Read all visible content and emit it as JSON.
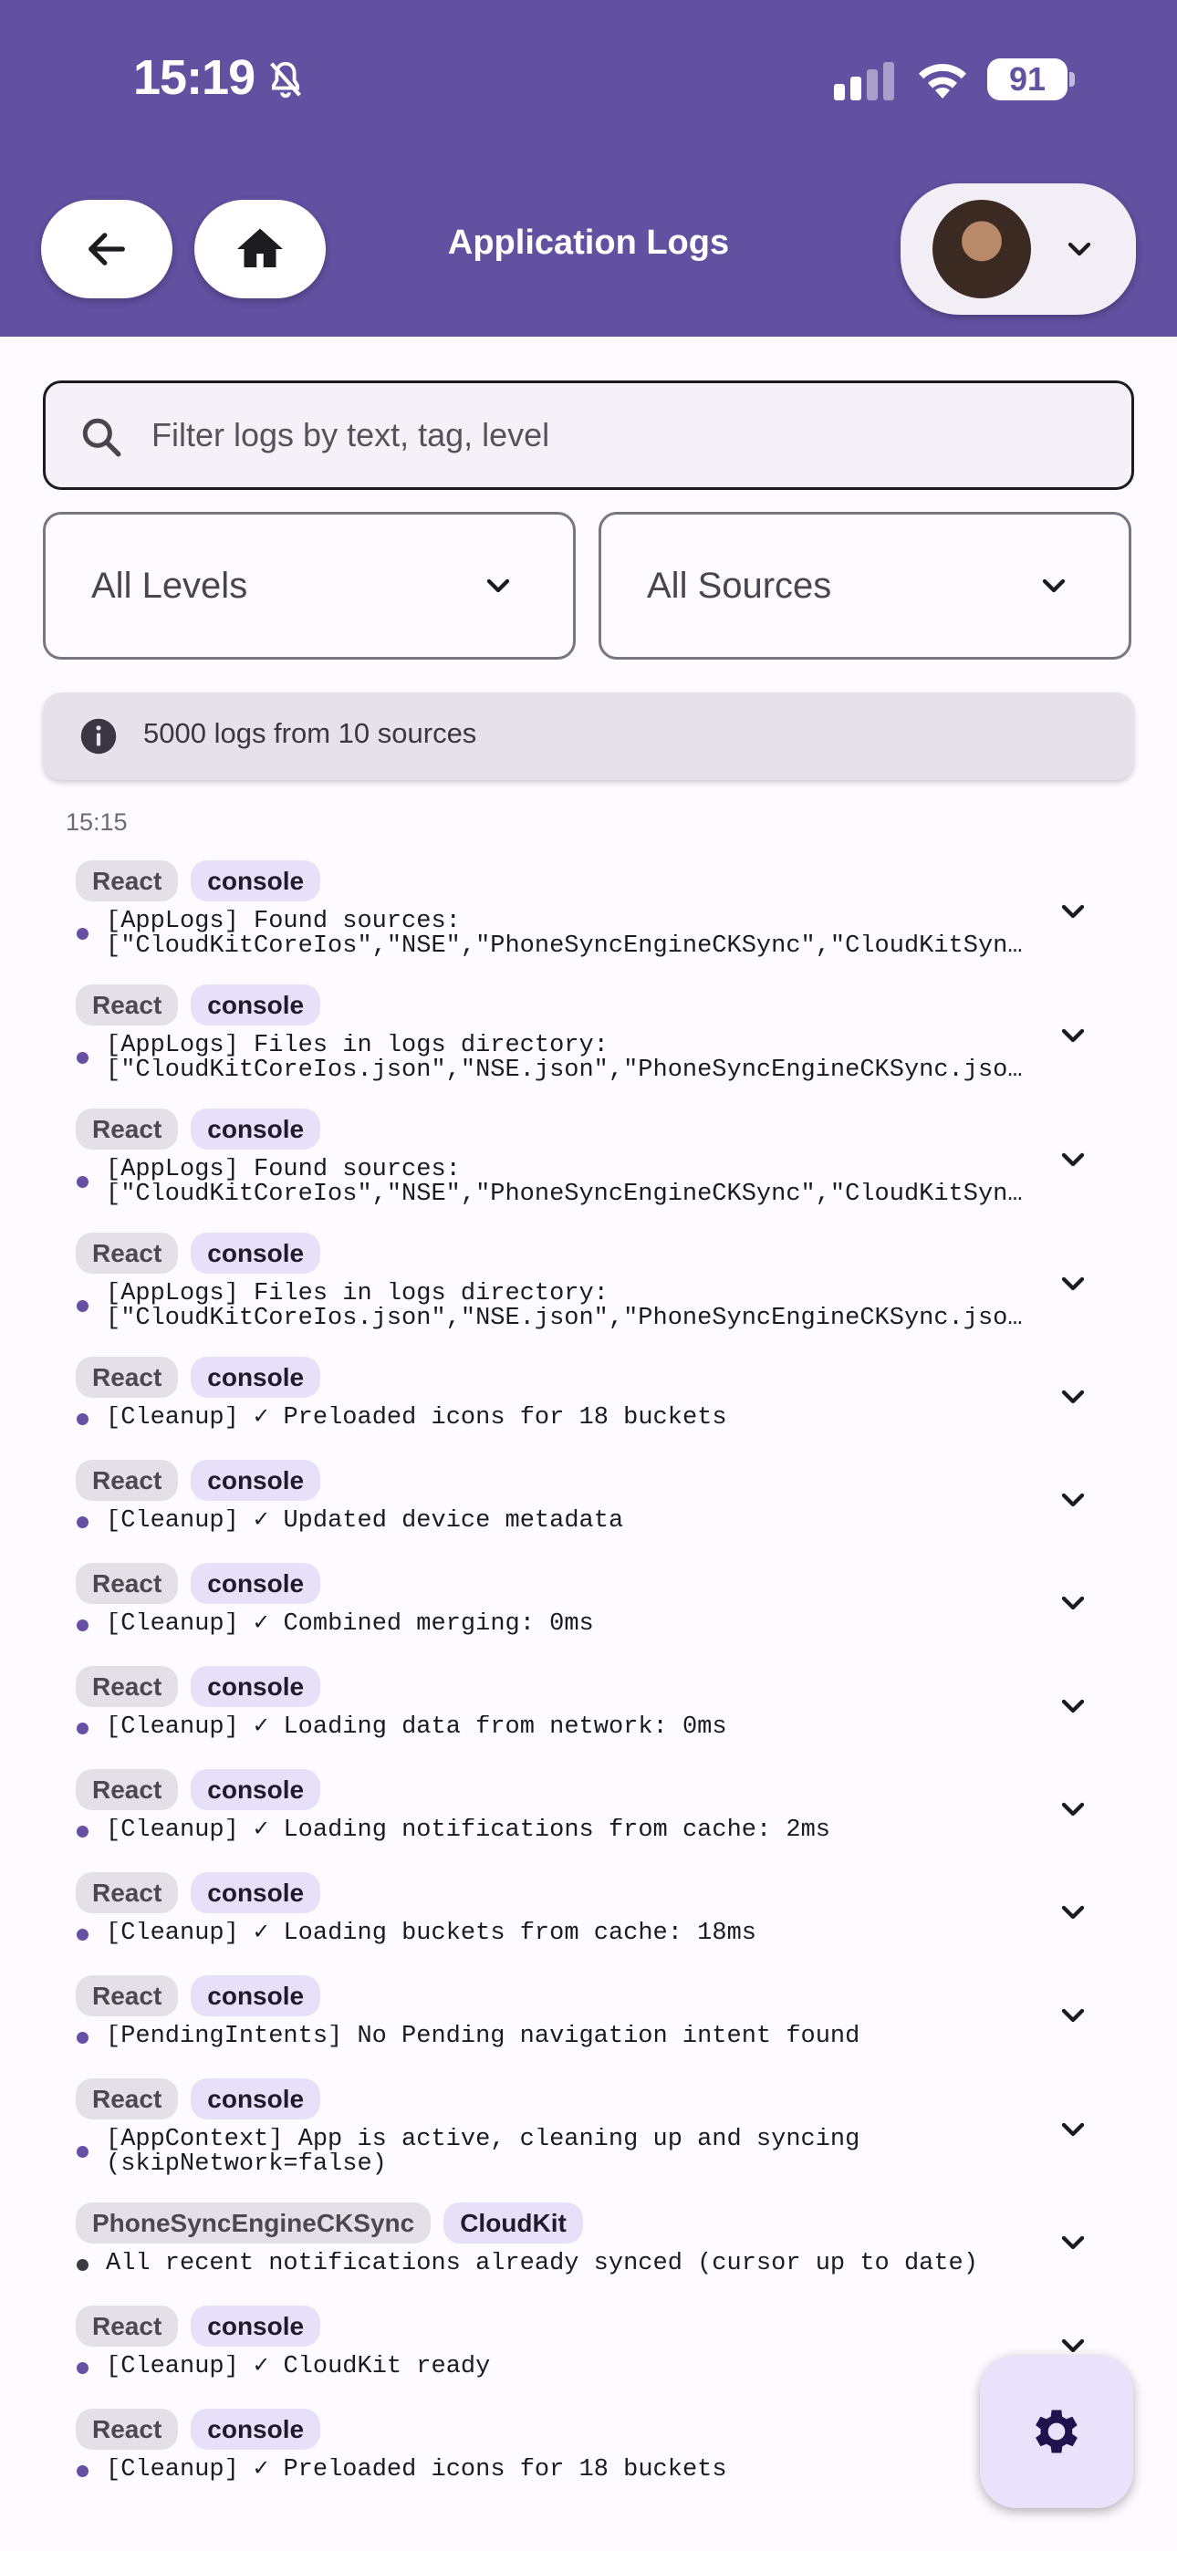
{
  "status_bar": {
    "time": "15:19",
    "battery": "91",
    "icons": [
      "bell-slash-icon",
      "cellular-signal-icon",
      "wifi-icon",
      "battery-icon"
    ]
  },
  "header": {
    "title": "Application Logs",
    "back_icon": "arrow-left-icon",
    "home_icon": "home-icon",
    "user_menu_icon": "chevron-down-icon"
  },
  "search": {
    "placeholder": "Filter logs by text, tag, level",
    "value": "",
    "icon": "search-icon"
  },
  "filters": {
    "level": {
      "selected": "All Levels"
    },
    "source": {
      "selected": "All Sources"
    }
  },
  "summary": {
    "icon": "info-icon",
    "text": "5000 logs from 10 sources"
  },
  "time_group": "15:15",
  "logs": [
    {
      "source": "React",
      "tag": "console",
      "lines": [
        "[AppLogs] Found sources:",
        "[\"CloudKitCoreIos\",\"NSE\",\"PhoneSyncEngineCKSync\",\"CloudKitSyncEngine\",\"React\"]"
      ]
    },
    {
      "source": "React",
      "tag": "console",
      "lines": [
        "[AppLogs] Files in logs directory:",
        "[\"CloudKitCoreIos.json\",\"NSE.json\",\"PhoneSyncEngineCKSync.json\",\"React.json\"]"
      ]
    },
    {
      "source": "React",
      "tag": "console",
      "lines": [
        "[AppLogs] Found sources:",
        "[\"CloudKitCoreIos\",\"NSE\",\"PhoneSyncEngineCKSync\",\"CloudKitSyncEngine\",\"React\"]"
      ]
    },
    {
      "source": "React",
      "tag": "console",
      "lines": [
        "[AppLogs] Files in logs directory:",
        "[\"CloudKitCoreIos.json\",\"NSE.json\",\"PhoneSyncEngineCKSync.json\",\"React.json\"]"
      ]
    },
    {
      "source": "React",
      "tag": "console",
      "lines": [
        "[Cleanup] ✓ Preloaded icons for 18 buckets"
      ]
    },
    {
      "source": "React",
      "tag": "console",
      "lines": [
        "[Cleanup] ✓ Updated device metadata"
      ]
    },
    {
      "source": "React",
      "tag": "console",
      "lines": [
        "[Cleanup] ✓ Combined merging: 0ms"
      ]
    },
    {
      "source": "React",
      "tag": "console",
      "lines": [
        "[Cleanup] ✓ Loading data from network: 0ms"
      ]
    },
    {
      "source": "React",
      "tag": "console",
      "lines": [
        "[Cleanup] ✓ Loading notifications from cache: 2ms"
      ]
    },
    {
      "source": "React",
      "tag": "console",
      "lines": [
        "[Cleanup] ✓ Loading buckets from cache: 18ms"
      ]
    },
    {
      "source": "React",
      "tag": "console",
      "lines": [
        "[PendingIntents] No Pending navigation intent found"
      ]
    },
    {
      "source": "React",
      "tag": "console",
      "lines": [
        "[AppContext] App is active, cleaning up and syncing",
        "(skipNetwork=false)"
      ]
    },
    {
      "source": "PhoneSyncEngineCKSync",
      "tag": "CloudKit",
      "lines": [
        "All recent notifications already synced (cursor up to date)"
      ],
      "dot": "dark"
    },
    {
      "source": "React",
      "tag": "console",
      "lines": [
        "[Cleanup] ✓ CloudKit ready"
      ]
    },
    {
      "source": "React",
      "tag": "console",
      "lines": [
        "[Cleanup] ✓ Preloaded icons for 18 buckets"
      ]
    }
  ],
  "fab": {
    "icon": "gear-icon"
  },
  "colors": {
    "header_bg": "#6250a1",
    "accent": "#6750a4",
    "chip_source_bg": "#e3e0e8",
    "chip_tag_bg": "#e8e0f8",
    "fab_bg": "#eae1fb"
  }
}
